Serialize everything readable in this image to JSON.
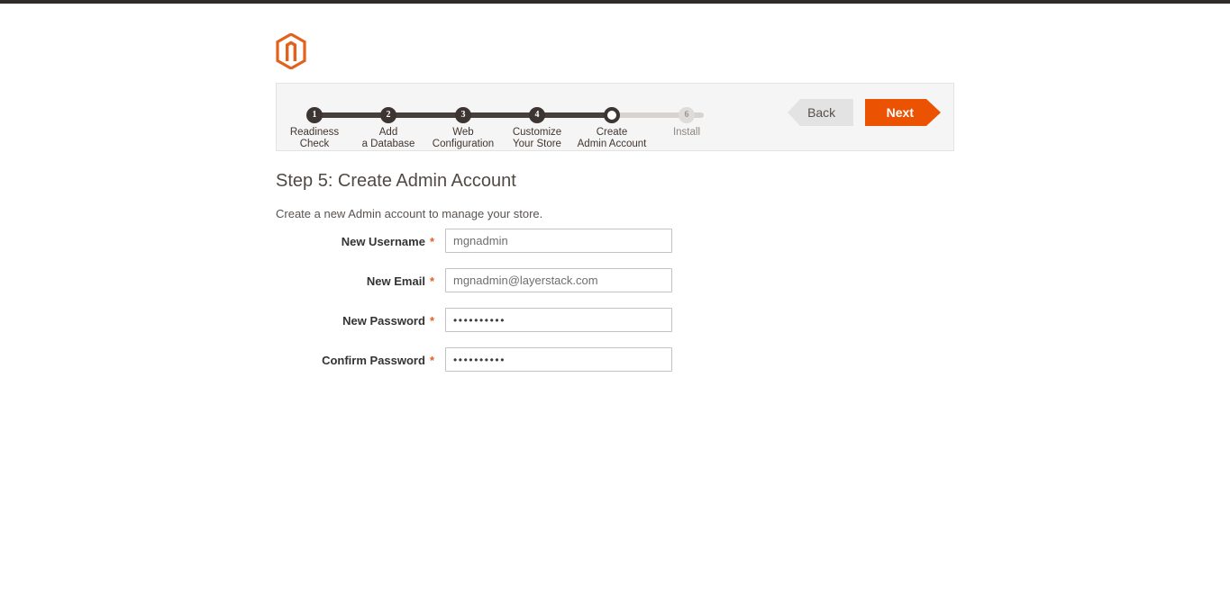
{
  "brand": {
    "logo_icon": "magento-logo-icon",
    "accent_color": "#eb5202",
    "dark_color": "#3c3531"
  },
  "progress": {
    "steps": [
      {
        "number": "1",
        "line1": "Readiness",
        "line2": "Check",
        "state": "done"
      },
      {
        "number": "2",
        "line1": "Add",
        "line2": "a Database",
        "state": "done"
      },
      {
        "number": "3",
        "line1": "Web",
        "line2": "Configuration",
        "state": "done"
      },
      {
        "number": "4",
        "line1": "Customize",
        "line2": "Your Store",
        "state": "done"
      },
      {
        "number": "5",
        "line1": "Create",
        "line2": "Admin Account",
        "state": "current"
      },
      {
        "number": "6",
        "line1": "Install",
        "line2": "",
        "state": "pending"
      }
    ],
    "back_label": "Back",
    "next_label": "Next"
  },
  "content": {
    "title": "Step 5: Create Admin Account",
    "subtitle": "Create a new Admin account to manage your store.",
    "required_marker": "*",
    "fields": [
      {
        "label": "New Username",
        "value": "mgnadmin",
        "type": "text",
        "name": "new-username"
      },
      {
        "label": "New Email",
        "value": "mgnadmin@layerstack.com",
        "type": "text",
        "name": "new-email"
      },
      {
        "label": "New Password",
        "value": "••••••••••",
        "type": "password",
        "name": "new-password"
      },
      {
        "label": "Confirm Password",
        "value": "••••••••••",
        "type": "password",
        "name": "confirm-password"
      }
    ]
  }
}
